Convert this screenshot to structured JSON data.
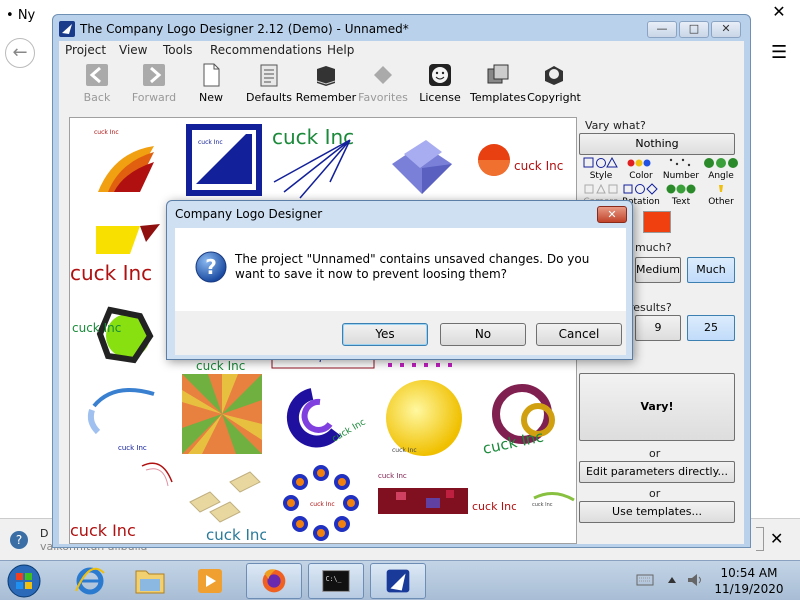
{
  "background": {
    "tab_label": "Ny",
    "notification_text": "D",
    "notification_text2": "vaikonnitun alibulla",
    "notification_close": "✕",
    "back_arrow": "←",
    "menu_icon": "☰",
    "close_icon": "✕"
  },
  "app": {
    "title": "The Company Logo Designer 2.12 (Demo) - Unnamed*",
    "minimize": "—",
    "maximize": "□",
    "close": "✕",
    "menu": [
      "Project",
      "View",
      "Tools",
      "Recommendations",
      "Help"
    ],
    "toolbar": [
      {
        "label": "Back",
        "enabled": false
      },
      {
        "label": "Forward",
        "enabled": false
      },
      {
        "label": "New",
        "enabled": true
      },
      {
        "label": "Defaults",
        "enabled": true
      },
      {
        "label": "Remember",
        "enabled": true
      },
      {
        "label": "Favorites",
        "enabled": false
      },
      {
        "label": "License",
        "enabled": true
      },
      {
        "label": "Templates",
        "enabled": true
      },
      {
        "label": "Copyright",
        "enabled": true
      }
    ]
  },
  "gallery": {
    "logo_text": "cuck Inc"
  },
  "panel": {
    "vary_what_label": "Vary what?",
    "nothing_button": "Nothing",
    "categories": [
      "Style",
      "Color",
      "Number",
      "Angle",
      "Camera",
      "Rotation",
      "Text",
      "Other"
    ],
    "how_much_label": "much?",
    "how_much_options": [
      "Medium",
      "Much"
    ],
    "how_much_selected": "Much",
    "results_label": "results?",
    "results_options": [
      "9",
      "25"
    ],
    "results_selected": "25",
    "vary_button": "Vary!",
    "or1": "or",
    "edit_params_button": "Edit parameters directly...",
    "or2": "or",
    "use_templates_button": "Use templates..."
  },
  "dialog": {
    "title": "Company Logo Designer",
    "message": "The project \"Unnamed\" contains unsaved changes. Do you want to save it now to prevent loosing them?",
    "buttons": {
      "yes": "Yes",
      "no": "No",
      "cancel": "Cancel"
    }
  },
  "taskbar": {
    "time": "10:54 AM",
    "date": "11/19/2020"
  },
  "colors": {
    "accent": "#3c7fb1",
    "logo_red": "#b01010",
    "logo_green": "#1a8a3a",
    "logo_blue": "#1a2a9a"
  }
}
